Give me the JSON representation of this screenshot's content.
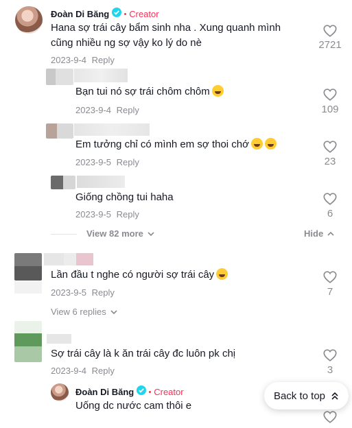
{
  "comments": [
    {
      "author": "Đoàn Di Băng",
      "badge": "Creator",
      "text_line1": "Hana sợ trái cây bẩm sinh nha . Xung quanh mình",
      "text_line2": "cũng nhiều ng sợ vậy ko lý do nè",
      "date": "2023-9-4",
      "reply_label": "Reply",
      "likes": "2721",
      "replies": [
        {
          "text": "Bạn tui nó sợ trái chôm chôm",
          "date": "2023-9-4",
          "reply_label": "Reply",
          "likes": "109"
        },
        {
          "text": "Em tưởng chỉ có mình em sợ thoi chớ",
          "date": "2023-9-5",
          "reply_label": "Reply",
          "likes": "23"
        },
        {
          "text": "Giống chồng tui haha",
          "date": "2023-9-5",
          "reply_label": "Reply",
          "likes": "6"
        }
      ],
      "view_more": "View 82 more",
      "hide": "Hide"
    },
    {
      "text": "Lần đầu t nghe có người sợ trái cây",
      "date": "2023-9-5",
      "reply_label": "Reply",
      "likes": "7",
      "view_replies": "View 6 replies"
    },
    {
      "text": "Sợ trái cây là k ăn trái cây đc luôn pk chị",
      "date": "2023-9-4",
      "reply_label": "Reply",
      "likes": "3",
      "reply": {
        "author": "Đoàn Di Băng",
        "badge": "Creator",
        "text": "Uống dc nước cam thôi e"
      }
    }
  ],
  "back_to_top": "Back to top",
  "colors": {
    "creator": "#fe2c55",
    "verified": "#20d5ec",
    "meta": "#8a8b91"
  }
}
